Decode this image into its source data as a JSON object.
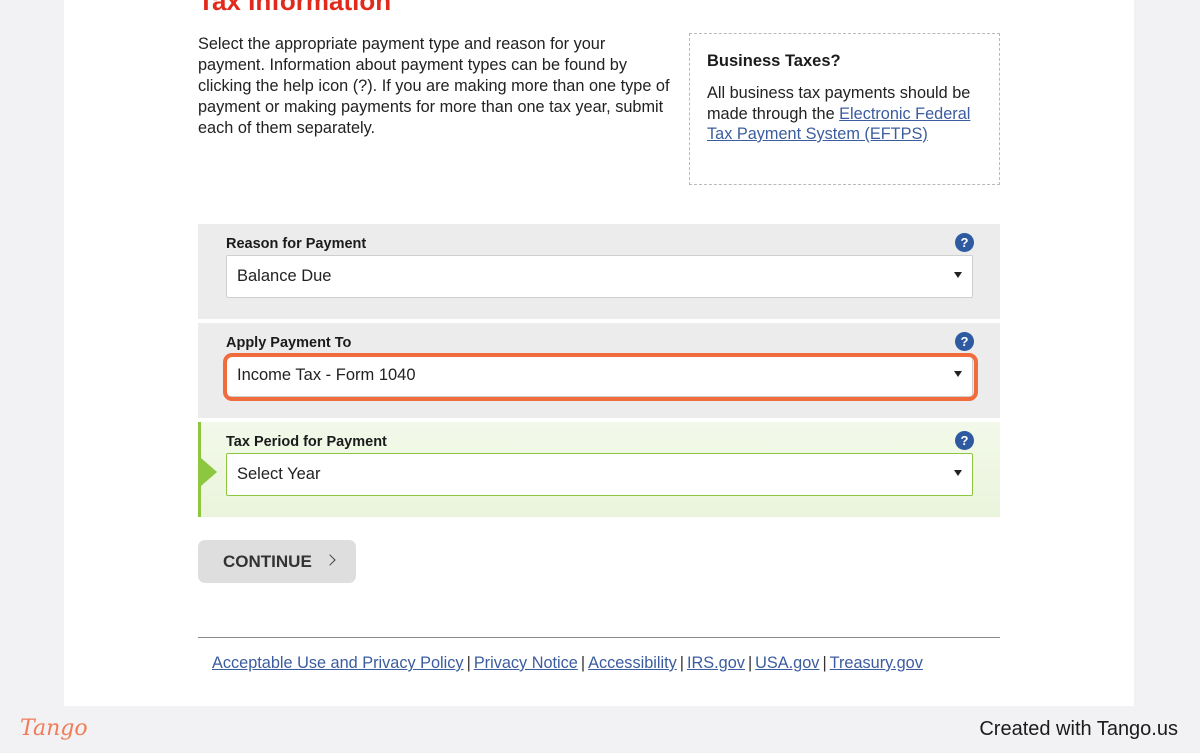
{
  "heading": "Tax Information",
  "intro": "Select the appropriate payment type and reason for your payment. Information about payment types can be found by clicking the help icon (?). If you are making more than one type of payment or making payments for more than one tax year, submit each of them separately.",
  "business_box": {
    "title": "Business Taxes?",
    "text": "All business tax payments should be made through the ",
    "link": "Electronic Federal Tax Payment System (EFTPS)"
  },
  "fields": [
    {
      "label": "Reason for Payment",
      "value": "Balance Due",
      "help": "?"
    },
    {
      "label": "Apply Payment To",
      "value": "Income Tax - Form 1040",
      "help": "?"
    },
    {
      "label": "Tax Period for Payment",
      "value": "Select Year",
      "help": "?"
    }
  ],
  "continue_label": "CONTINUE",
  "footer_links": [
    "Acceptable Use and Privacy Policy",
    "Privacy Notice",
    "Accessibility",
    "IRS.gov",
    "USA.gov",
    "Treasury.gov"
  ],
  "footer_separator": "|",
  "tango": {
    "logo": "Tango",
    "credit": "Created with Tango.us"
  },
  "colors": {
    "heading": "#e22a1c",
    "link": "#3b5c9e",
    "active_accent": "#8dc63f",
    "highlight": "#f06c3c",
    "help_icon": "#2d5aa1"
  }
}
